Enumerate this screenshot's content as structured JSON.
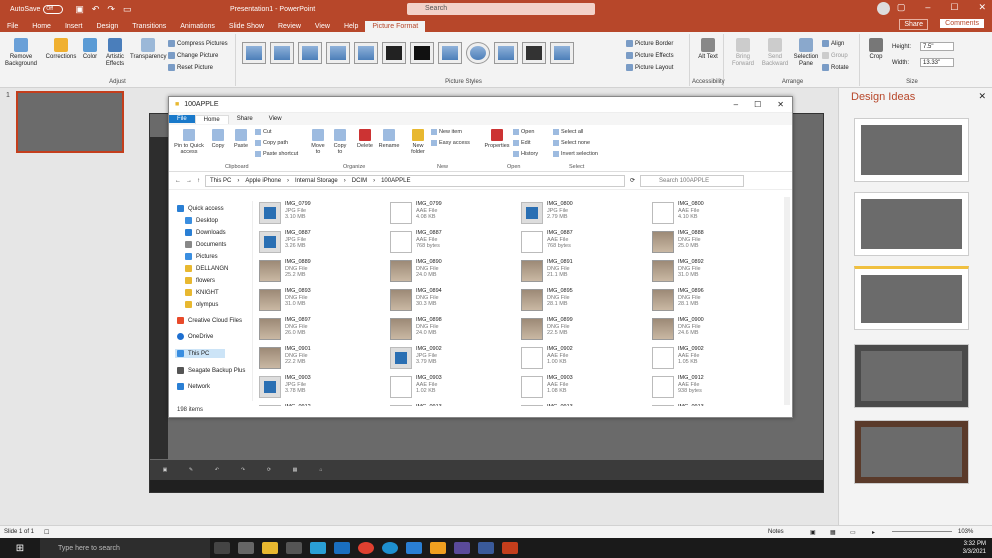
{
  "titlebar": {
    "autosave": "AutoSave",
    "autosave_state": "Off",
    "title": "Presentation1 - PowerPoint",
    "search_placeholder": "Search"
  },
  "menu": {
    "items": [
      "File",
      "Home",
      "Insert",
      "Design",
      "Transitions",
      "Animations",
      "Slide Show",
      "Review",
      "View",
      "Help",
      "Picture Format"
    ],
    "active": "Picture Format",
    "share": "Share",
    "comments": "Comments"
  },
  "ribbon": {
    "adjust": {
      "remove_bg": "Remove Background",
      "corrections": "Corrections",
      "color": "Color",
      "artistic": "Artistic Effects",
      "transparency": "Transparency",
      "compress": "Compress Pictures",
      "change": "Change Picture",
      "reset": "Reset Picture",
      "label": "Adjust"
    },
    "styles": {
      "border": "Picture Border",
      "effects": "Picture Effects",
      "layout": "Picture Layout",
      "label": "Picture Styles"
    },
    "accessibility": {
      "alt": "Alt Text",
      "label": "Accessibility"
    },
    "arrange": {
      "bring": "Bring Forward",
      "send": "Send Backward",
      "selection": "Selection Pane",
      "align": "Align",
      "group": "Group",
      "rotate": "Rotate",
      "label": "Arrange"
    },
    "size": {
      "crop": "Crop",
      "height_label": "Height:",
      "height": "7.5\"",
      "width_label": "Width:",
      "width": "13.33\"",
      "label": "Size"
    }
  },
  "slides": {
    "number": "1"
  },
  "explorer": {
    "title": "100APPLE",
    "tabs": [
      "File",
      "Home",
      "Share",
      "View"
    ],
    "clipboard": {
      "pin": "Pin to Quick access",
      "copy": "Copy",
      "paste": "Paste",
      "cut": "Cut",
      "copy_path": "Copy path",
      "paste_shortcut": "Paste shortcut",
      "label": "Clipboard"
    },
    "organize": {
      "move": "Move to",
      "copy": "Copy to",
      "delete": "Delete",
      "rename": "Rename",
      "label": "Organize"
    },
    "new": {
      "folder": "New folder",
      "new_item": "New item",
      "easy_access": "Easy access",
      "label": "New"
    },
    "open": {
      "properties": "Properties",
      "open": "Open",
      "edit": "Edit",
      "history": "History",
      "label": "Open"
    },
    "select": {
      "all": "Select all",
      "none": "Select none",
      "invert": "Invert selection",
      "label": "Select"
    },
    "path": [
      "This PC",
      "Apple iPhone",
      "Internal Storage",
      "DCIM",
      "100APPLE"
    ],
    "search_placeholder": "Search 100APPLE",
    "nav": [
      "Quick access",
      "Desktop",
      "Downloads",
      "Documents",
      "Pictures",
      "DELLANGN",
      "flowers",
      "KNIGHT",
      "olympus",
      "Creative Cloud Files",
      "OneDrive",
      "This PC",
      "Seagate Backup Plus",
      "Network"
    ],
    "status": "198 items",
    "files": [
      {
        "name": "IMG_0799",
        "type": "JPG File",
        "size": "3.10 MB",
        "kind": "jpg"
      },
      {
        "name": "IMG_0799",
        "type": "AAE File",
        "size": "4.08 KB",
        "kind": "aae"
      },
      {
        "name": "IMG_0800",
        "type": "JPG File",
        "size": "2.79 MB",
        "kind": "jpg"
      },
      {
        "name": "IMG_0800",
        "type": "AAE File",
        "size": "4.10 KB",
        "kind": "aae"
      },
      {
        "name": "IMG_0887",
        "type": "JPG File",
        "size": "3.26 MB",
        "kind": "jpg"
      },
      {
        "name": "IMG_0887",
        "type": "AAE File",
        "size": "768 bytes",
        "kind": "aae"
      },
      {
        "name": "IMG_0887",
        "type": "AAE File",
        "size": "768 bytes",
        "kind": "aae"
      },
      {
        "name": "IMG_0888",
        "type": "DNG File",
        "size": "25.0 MB",
        "kind": "dng"
      },
      {
        "name": "IMG_0889",
        "type": "DNG File",
        "size": "25.2 MB",
        "kind": "dng"
      },
      {
        "name": "IMG_0890",
        "type": "DNG File",
        "size": "24.0 MB",
        "kind": "dng"
      },
      {
        "name": "IMG_0891",
        "type": "DNG File",
        "size": "21.1 MB",
        "kind": "dng"
      },
      {
        "name": "IMG_0892",
        "type": "DNG File",
        "size": "31.0 MB",
        "kind": "dng"
      },
      {
        "name": "IMG_0893",
        "type": "DNG File",
        "size": "31.0 MB",
        "kind": "dng"
      },
      {
        "name": "IMG_0894",
        "type": "DNG File",
        "size": "30.3 MB",
        "kind": "dng"
      },
      {
        "name": "IMG_0895",
        "type": "DNG File",
        "size": "28.1 MB",
        "kind": "dng"
      },
      {
        "name": "IMG_0896",
        "type": "DNG File",
        "size": "28.1 MB",
        "kind": "dng"
      },
      {
        "name": "IMG_0897",
        "type": "DNG File",
        "size": "26.0 MB",
        "kind": "dng"
      },
      {
        "name": "IMG_0898",
        "type": "DNG File",
        "size": "24.0 MB",
        "kind": "dng"
      },
      {
        "name": "IMG_0899",
        "type": "DNG File",
        "size": "22.5 MB",
        "kind": "dng"
      },
      {
        "name": "IMG_0900",
        "type": "DNG File",
        "size": "24.6 MB",
        "kind": "dng"
      },
      {
        "name": "IMG_0901",
        "type": "DNG File",
        "size": "22.2 MB",
        "kind": "dng"
      },
      {
        "name": "IMG_0902",
        "type": "JPG File",
        "size": "3.79 MB",
        "kind": "jpg"
      },
      {
        "name": "IMG_0902",
        "type": "AAE File",
        "size": "1.00 KB",
        "kind": "aae"
      },
      {
        "name": "IMG_0902",
        "type": "AAE File",
        "size": "1.05 KB",
        "kind": "aae"
      },
      {
        "name": "IMG_0903",
        "type": "JPG File",
        "size": "3.78 MB",
        "kind": "jpg"
      },
      {
        "name": "IMG_0903",
        "type": "AAE File",
        "size": "1.02 KB",
        "kind": "aae"
      },
      {
        "name": "IMG_0903",
        "type": "AAE File",
        "size": "1.08 KB",
        "kind": "aae"
      },
      {
        "name": "IMG_0912",
        "type": "AAE File",
        "size": "938 bytes",
        "kind": "aae"
      },
      {
        "name": "IMG_0912",
        "type": "",
        "size": "",
        "kind": "jpg"
      },
      {
        "name": "IMG_0913",
        "type": "",
        "size": "",
        "kind": "aae"
      },
      {
        "name": "IMG_0913",
        "type": "",
        "size": "",
        "kind": "aae"
      },
      {
        "name": "IMG_0913",
        "type": "",
        "size": "",
        "kind": "aae"
      }
    ]
  },
  "design": {
    "title": "Design Ideas"
  },
  "status": {
    "slide": "Slide 1 of 1",
    "notes": "Notes",
    "zoom": "103%"
  },
  "taskbar": {
    "search": "Type here to search",
    "time": "3:32 PM",
    "date": "3/3/2021"
  }
}
